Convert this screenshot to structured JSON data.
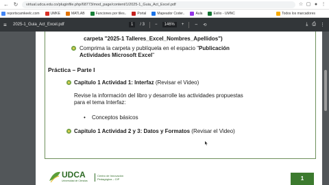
{
  "browser": {
    "url": "virtual.udca.edu.co/pluginfile.php/68773/mod_page/content/1/2025-1_Guia_Act_Excel.pdf",
    "bookmarks": [
      {
        "label": "reportscamkeelc.com",
        "color": "#4285f4"
      },
      {
        "label": "UMKE",
        "color": "#d93025"
      },
      {
        "label": "MATLAB",
        "color": "#e37400"
      },
      {
        "label": "Funciones por tiles..",
        "color": "#188038"
      },
      {
        "label": "Portal",
        "color": "#c5221f"
      },
      {
        "label": "Mapeador Coder..",
        "color": "#1a73e8"
      },
      {
        "label": "Aula",
        "color": "#9334e6"
      },
      {
        "label": "Exilio - UMNC",
        "color": "#137333"
      }
    ],
    "bookmarks_right": "Todos los marcadores"
  },
  "pdf": {
    "title": "2025-1_Guia_Act_Excel.pdf",
    "page_current": "1",
    "page_total": "/ 3",
    "zoom": "146%",
    "zoom_minus": "−",
    "zoom_plus": "+"
  },
  "document": {
    "line_carpeta": "carpeta \"2025-1 Talleres_Excel_Nombres_Apellidos\")",
    "comprima_pre": "Comprima la carpeta y publíquela en el espacio \"",
    "comprima_bold": "Publicación",
    "comprima_line2": "Actividades Microsoft Excel",
    "comprima_end": "\"",
    "section": "Práctica – Parte I",
    "cap1_bold": "Capitulo 1 Actividad 1: Interfaz",
    "cap1_rest": " (Revisar el Video)",
    "revise_line1": "Revise la información del libro y desarrolle las actividades propuestas",
    "revise_line2": "para el tema Interfaz:",
    "bullet": "Conceptos básicos",
    "cap2_bold": "Capitulo 1 Actividad 2 y 3: Datos y Formatos",
    "cap2_rest": " (Revisar el Video)",
    "logo_text": "UDCA",
    "logo_sub1": "Centro de Innovación",
    "logo_sub2": "Pedagógica – CIP",
    "page_number": "1"
  },
  "colors": {
    "toolbar": "#323639",
    "viewer_bg": "#525659",
    "frame_green": "#6d8f5a",
    "page_num_bg": "#3c7a2e"
  }
}
